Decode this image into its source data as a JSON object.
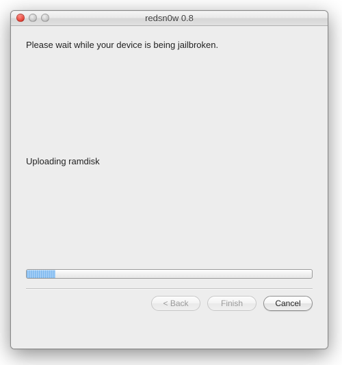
{
  "window": {
    "title": "redsn0w 0.8"
  },
  "content": {
    "main_message": "Please wait while your device is being jailbroken.",
    "status_message": "Uploading ramdisk",
    "progress_percent": 10
  },
  "buttons": {
    "back_label": "< Back",
    "finish_label": "Finish",
    "cancel_label": "Cancel"
  }
}
